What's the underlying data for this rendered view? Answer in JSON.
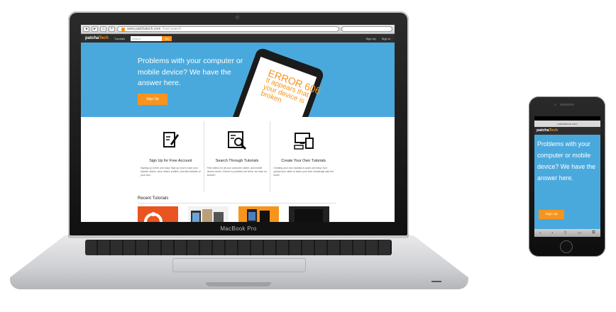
{
  "device_labels": {
    "laptop": "MacBook Pro"
  },
  "browser": {
    "url": "www.patchatech.com",
    "search_placeholder": "Fast search",
    "buttons": [
      "◂",
      "▸",
      "⌂",
      "+"
    ]
  },
  "site": {
    "logo_main": "patcha",
    "logo_accent": "Tech",
    "nav": {
      "tutorials": "Tutorials",
      "search_placeholder": "Search",
      "go": "Go",
      "sign_up": "Sign Up",
      "sign_in": "Sign in"
    },
    "hero": {
      "headline": "Problems with your computer or mobile device? We have the answer here.",
      "signup_label": "Sign Up",
      "error_title": "ERROR 606",
      "error_body": "It appears that your device is broken"
    },
    "features": [
      {
        "title": "Sign Up for Free Account",
        "body": "Signing up is free and easy! Sign up now to save your favorite videos, save others' profiles, and add tutorials of your own.",
        "icon": "edit-document-icon"
      },
      {
        "title": "Search Through Tutorials",
        "body": "Find videos for all your computer, tablet, and mobile device needs. If there's a problem out there, we have an answer!",
        "icon": "search-document-icon"
      },
      {
        "title": "Create Your Own Tutorials",
        "body": "Creating your own tutorials is quick and easy! Just upload your video to share your tech knowledge with the world.",
        "icon": "devices-icon"
      }
    ],
    "recent_title": "Recent Tutorials",
    "thumbnails": [
      "ubuntu-thumbnail",
      "phones-thumbnail",
      "smartphones-thumbnail",
      "tablet-thumbnail"
    ]
  },
  "mobile": {
    "url": "patchatech.com",
    "headline": "Problems with your computer or mobile device? We have the answer here.",
    "signup_label": "Sign Up",
    "toolbar": [
      "‹",
      "›",
      "⇧",
      "▭",
      "⧉"
    ]
  },
  "colors": {
    "accent": "#f7941d",
    "hero_blue": "#4aa9dc",
    "nav_dark": "#2e2e2e"
  }
}
